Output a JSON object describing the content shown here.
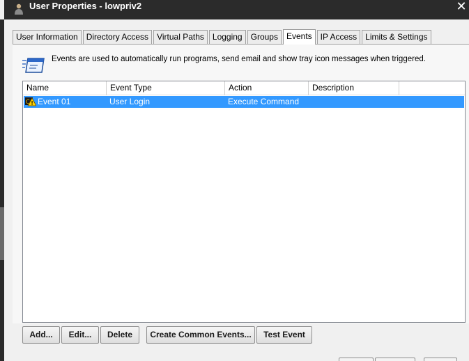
{
  "window": {
    "title": "User Properties - lowpriv2",
    "close_label": "✕"
  },
  "tabs": [
    {
      "label": "User Information"
    },
    {
      "label": "Directory Access"
    },
    {
      "label": "Virtual Paths"
    },
    {
      "label": "Logging"
    },
    {
      "label": "Groups"
    },
    {
      "label": "Events",
      "active": true
    },
    {
      "label": "IP Access"
    },
    {
      "label": "Limits & Settings"
    }
  ],
  "info": {
    "text": "Events are used to automatically run programs, send email and show tray icon messages when triggered."
  },
  "list": {
    "columns": [
      "Name",
      "Event Type",
      "Action",
      "Description"
    ],
    "rows": [
      {
        "name": "Event 01",
        "event_type": "User Login",
        "action": "Execute Command",
        "description": "",
        "selected": true
      }
    ]
  },
  "buttons": {
    "add": "Add...",
    "edit": "Edit...",
    "delete": "Delete",
    "create_common": "Create Common Events...",
    "test": "Test Event"
  },
  "colors": {
    "selection": "#3399ff",
    "titlebar": "#2b2b2b"
  }
}
